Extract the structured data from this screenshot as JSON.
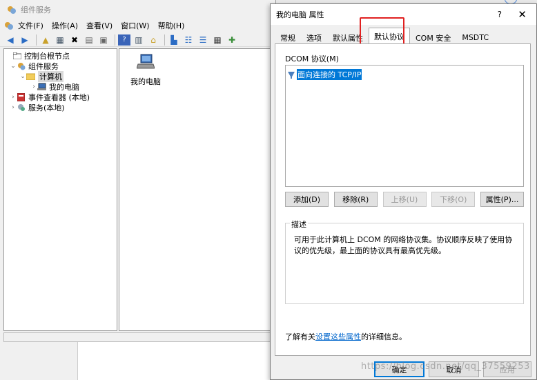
{
  "mmc": {
    "title": "组件服务",
    "menu": [
      "文件(F)",
      "操作(A)",
      "查看(V)",
      "窗口(W)",
      "帮助(H)"
    ],
    "tree": [
      {
        "label": "控制台根节点",
        "expander": "",
        "icon": "folder-icon"
      },
      {
        "label": "组件服务",
        "expander": "⌄",
        "icon": "component-services-icon"
      },
      {
        "label": "计算机",
        "expander": "⌄",
        "icon": "folder-icon",
        "selected": true
      },
      {
        "label": "我的电脑",
        "expander": "›",
        "icon": "computer-icon"
      },
      {
        "label": "事件查看器 (本地)",
        "expander": "›",
        "icon": "event-viewer-icon"
      },
      {
        "label": "服务(本地)",
        "expander": "›",
        "icon": "services-icon"
      }
    ],
    "content_item": "我的电脑"
  },
  "dialog": {
    "title": "我的电脑 属性",
    "help": "?",
    "close": "✕",
    "tabs": [
      "常规",
      "选项",
      "默认属性",
      "默认协议",
      "COM 安全",
      "MSDTC"
    ],
    "active_tab": "默认协议",
    "section_label": "DCOM 协议(M)",
    "protocols": [
      "面向连接的 TCP/IP"
    ],
    "buttons": {
      "add": "添加(D)",
      "remove": "移除(R)",
      "move_up": "上移(U)",
      "move_down": "下移(O)",
      "properties": "属性(P)..."
    },
    "description": {
      "legend": "描述",
      "text": "可用于此计算机上 DCOM 的网络协议集。协议顺序反映了使用协议的优先级，最上面的协议具有最高优先级。"
    },
    "more_info": {
      "prefix": "了解有关",
      "link": "设置这些属性",
      "suffix": "的详细信息。"
    },
    "footer": {
      "ok": "确定",
      "cancel": "取消",
      "apply": "应用"
    }
  },
  "watermark": "https://blog.csdn.net/qq_37559253",
  "colors": {
    "selection": "#0078d7",
    "highlight_box": "#e02020",
    "link": "#0066cc"
  }
}
